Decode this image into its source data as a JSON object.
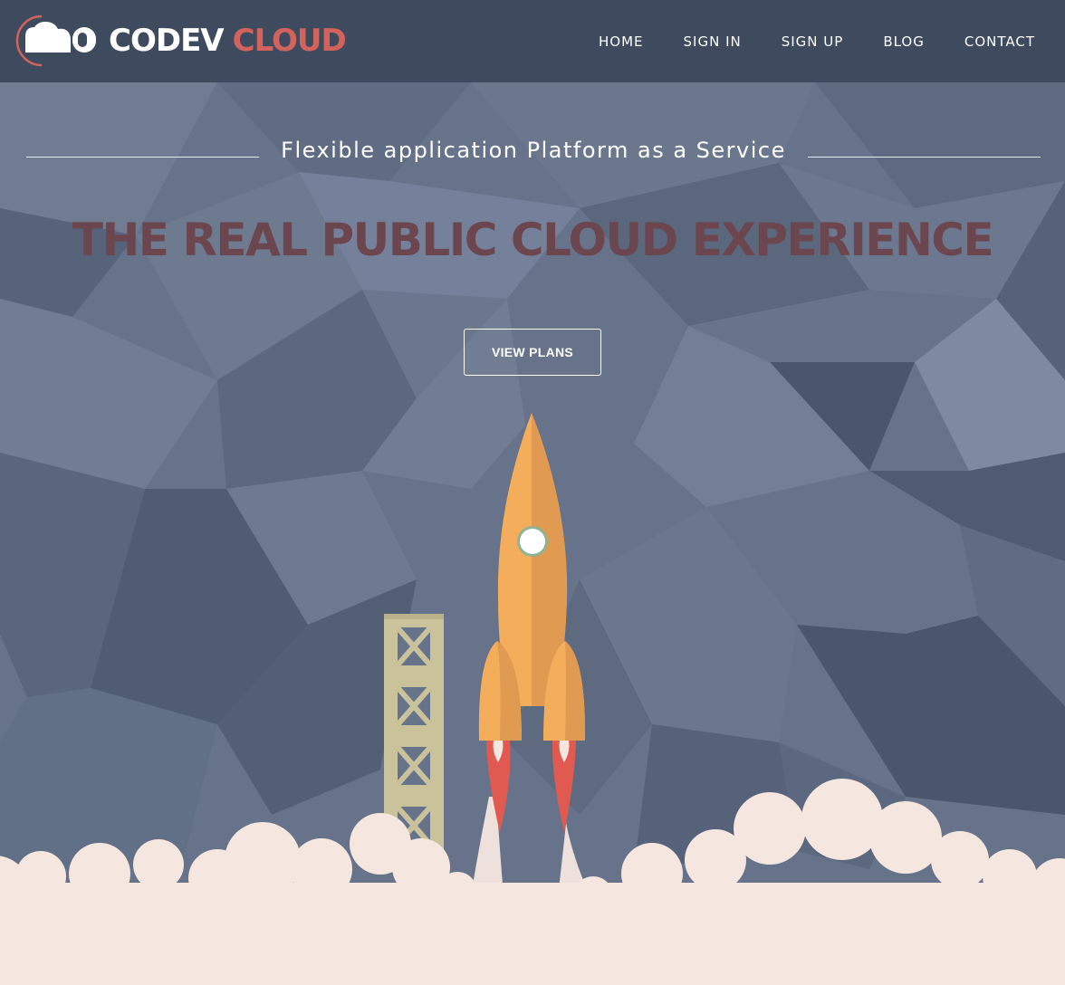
{
  "brand": {
    "logo_text_primary": "CODEV",
    "logo_text_secondary": "CLOUD",
    "accent_color": "#d2635c"
  },
  "nav": {
    "items": [
      {
        "label": "HOME"
      },
      {
        "label": "SIGN IN"
      },
      {
        "label": "SIGN UP"
      },
      {
        "label": "BLOG"
      },
      {
        "label": "CONTACT"
      }
    ]
  },
  "hero": {
    "tagline": "Flexible application Platform as a Service",
    "headline": "THE REAL PUBLIC CLOUD EXPERIENCE",
    "cta_label": "VIEW PLANS"
  },
  "illustration": {
    "icons": [
      "rocket-icon",
      "launch-tower-icon",
      "smoke-clouds"
    ],
    "colors": {
      "background": "#66738a",
      "header": "#3e4a5e",
      "rocket": "#f4ad5a",
      "flame": "#e05a52",
      "tower": "#c9c29b",
      "smoke": "#f5e7df",
      "headline": "#6b464e"
    }
  }
}
